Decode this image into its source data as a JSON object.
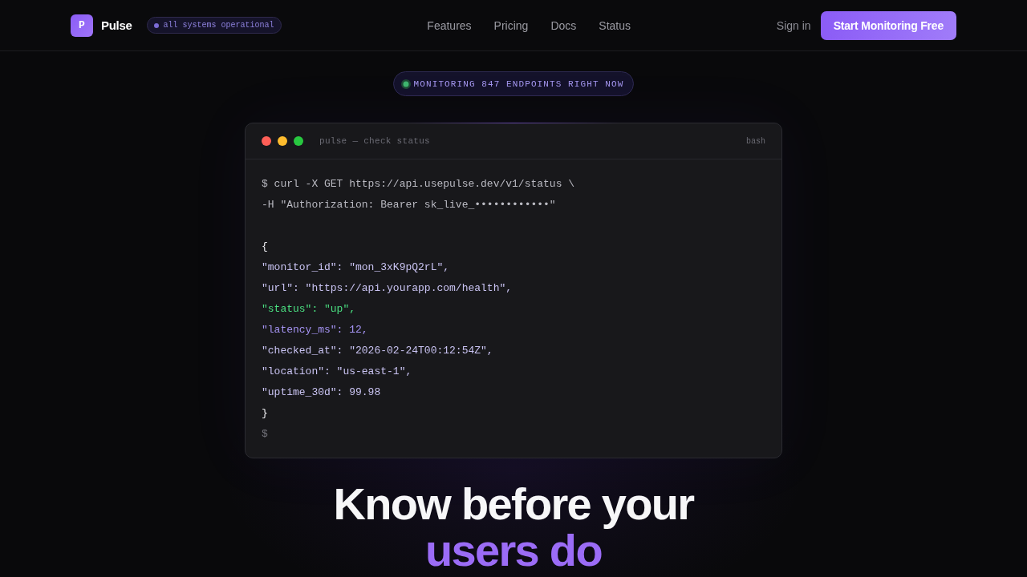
{
  "nav": {
    "brand": {
      "logo_letter": "P",
      "name": "Pulse"
    },
    "status_pill": "all systems operational",
    "links": [
      "Features",
      "Pricing",
      "Docs",
      "Status"
    ],
    "sign_in": "Sign in",
    "cta": "Start Monitoring Free"
  },
  "badge": "MONITORING 847 ENDPOINTS RIGHT NOW",
  "terminal": {
    "title": "pulse — check status",
    "shell": "bash",
    "command": [
      "$ curl -X GET https://api.usepulse.dev/v1/status \\",
      "-H \"Authorization: Bearer sk_live_••••••••••••\""
    ],
    "response": [
      {
        "kind": "brace",
        "text": "{"
      },
      {
        "kind": "field",
        "text": "\"monitor_id\": \"mon_3xK9pQ2rL\","
      },
      {
        "kind": "field",
        "text": "\"url\": \"https://api.yourapp.com/health\","
      },
      {
        "kind": "success",
        "text": "\"status\": \"up\","
      },
      {
        "kind": "metric",
        "text": "\"latency_ms\": 12,"
      },
      {
        "kind": "field",
        "text": "\"checked_at\": \"2026-02-24T00:12:54Z\","
      },
      {
        "kind": "field",
        "text": "\"location\": \"us-east-1\","
      },
      {
        "kind": "field",
        "text": "\"uptime_30d\": 99.98"
      },
      {
        "kind": "brace",
        "text": "}"
      }
    ],
    "prompt": "$"
  },
  "hero": {
    "headline": [
      {
        "kind": "plain",
        "text": "Know before your"
      },
      {
        "kind": "accent",
        "text": "users do"
      }
    ]
  }
}
